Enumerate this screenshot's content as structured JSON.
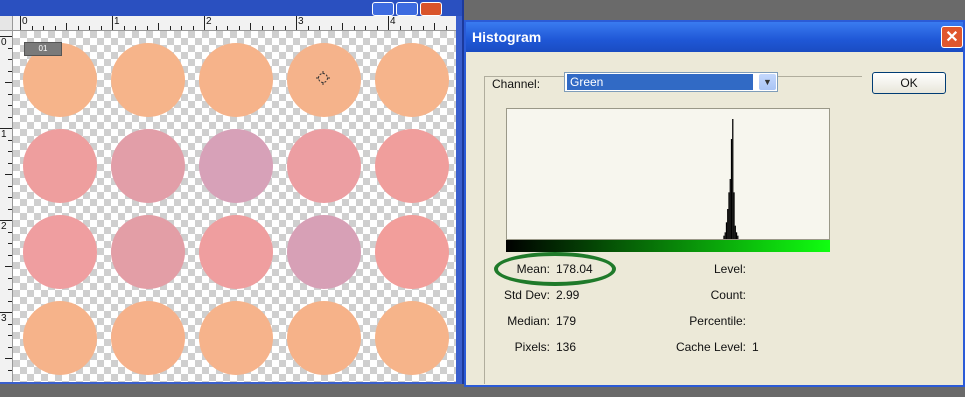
{
  "document": {
    "ruler_numbers": [
      "0",
      "1",
      "2",
      "3",
      "4"
    ],
    "side_ruler_numbers": [
      "0",
      "1",
      "2",
      "3"
    ],
    "selection_badge": "01",
    "circle_colors": [
      [
        "#f6b48a",
        "#f6b48a",
        "#f6b38a",
        "#f5b38b",
        "#f6b48b"
      ],
      [
        "#ee9e9e",
        "#e29ea8",
        "#d7a1b8",
        "#ec9ea2",
        "#f09e9c"
      ],
      [
        "#ef9ea0",
        "#e39ea6",
        "#ef9e9f",
        "#d7a0b6",
        "#f29e9b"
      ],
      [
        "#f6b38a",
        "#f6b18a",
        "#f6b38b",
        "#f6b289",
        "#f6b48a"
      ]
    ]
  },
  "histogram": {
    "title": "Histogram",
    "close_glyph": "✕",
    "channel_label": "Channel:",
    "channel_value": "Green",
    "ok_label": "OK",
    "stats_left": [
      {
        "label": "Mean:",
        "value": "178.04"
      },
      {
        "label": "Std Dev:",
        "value": "2.99"
      },
      {
        "label": "Median:",
        "value": "179"
      },
      {
        "label": "Pixels:",
        "value": "136"
      }
    ],
    "stats_right": [
      {
        "label": "Level:",
        "value": ""
      },
      {
        "label": "Count:",
        "value": ""
      },
      {
        "label": "Percentile:",
        "value": ""
      },
      {
        "label": "Cache Level:",
        "value": "1"
      }
    ],
    "accent_color": "#2b5bd7",
    "highlight_color": "#1f7a2a"
  },
  "chart_data": {
    "type": "bar",
    "x": [
      172,
      173,
      174,
      175,
      176,
      177,
      178,
      179,
      180,
      181,
      182,
      183,
      184
    ],
    "values": [
      1,
      2,
      5,
      9,
      14,
      18,
      30,
      36,
      14,
      4,
      2,
      1,
      0
    ],
    "xlim": [
      0,
      255
    ],
    "ylim": [
      0,
      36
    ],
    "grid": false
  }
}
